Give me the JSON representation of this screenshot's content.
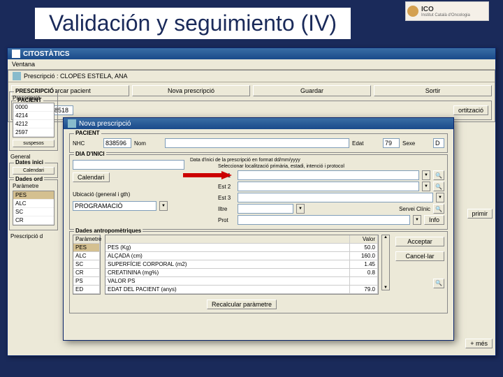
{
  "logo": {
    "brand": "ICO",
    "sub": "Institut Català d'Oncologia"
  },
  "slide_title": "Validación y seguimiento (IV)",
  "app": {
    "title": "CITOSTÀTICS",
    "menu": "Ventana",
    "subwin_title": "Prescripció : CLOPES ESTELA, ANA",
    "toolbar": {
      "search": "Cercar pacient",
      "new": "Nova prescripció",
      "save": "Guardar",
      "exit": "Sortir"
    },
    "patient_section": "PACIENT",
    "nhc_label": "NHC",
    "nhc_value": "988518",
    "auth_btn": "ortització",
    "presc_section": "PRESCRIPCIÓ",
    "presc_label": "Prescripció",
    "presc_list": [
      "0000",
      "4214",
      "4212",
      "2597"
    ],
    "sub_btn": "suspesos",
    "general_tab": "General",
    "dates_label": "Dates inici",
    "calendar_btn": "Calendari",
    "dates_ord": "Dades ord",
    "param_label": "Paràmetre",
    "params": [
      "PES",
      "ALC",
      "SC",
      "CR"
    ],
    "presc_d": "Prescripció d",
    "right_btn": "primir"
  },
  "modal": {
    "title": "Nova prescripció",
    "patient_section": "PACIENT",
    "nhc_label": "NHC",
    "nhc_value": "838596",
    "nom_label": "Nom",
    "edat_label": "Edat",
    "edat_value": "79",
    "sexe_label": "Sexe",
    "sexe_value": "D",
    "dia_section": "DIA D'INICI",
    "calendar_btn": "Calendari",
    "date_label": "Data d'inici de la prescripció en format dd/mm/yyyy",
    "select_label": "Seleccionar localització primària, estadi, intenció i protocol",
    "fields": [
      "Est 1",
      "Est 2",
      "Est 3",
      "Iltre",
      "Prot"
    ],
    "servei_label": "Servei Clínic",
    "info_btn": "Info",
    "ubic_label": "Ubicació (general i gth)",
    "ubic_value": "PROGRAMACIÓ",
    "anthro_section": "Dades antropomètriques",
    "grid_headers": {
      "param": "Paràmetre",
      "desc": "",
      "valor": "Valor"
    },
    "grid_rows": [
      {
        "code": "PES",
        "desc": "PES (Kg)",
        "valor": "50.0"
      },
      {
        "code": "ALC",
        "desc": "ALÇADA (cm)",
        "valor": "160.0"
      },
      {
        "code": "SC",
        "desc": "SUPERFÍCIE CORPORAL (m2)",
        "valor": "1.45"
      },
      {
        "code": "CR",
        "desc": "CREATININA (mg%)",
        "valor": "0.8"
      },
      {
        "code": "PS",
        "desc": "VALOR PS",
        "valor": ""
      },
      {
        "code": "ED",
        "desc": "EDAT DEL PACIENT (anys)",
        "valor": "79.0"
      }
    ],
    "acceptar_btn": "Acceptar",
    "cancelar_btn": "Cancel·lar",
    "recalc_btn": "Recalcular paràmetre",
    "mes_btn": "+ més"
  }
}
